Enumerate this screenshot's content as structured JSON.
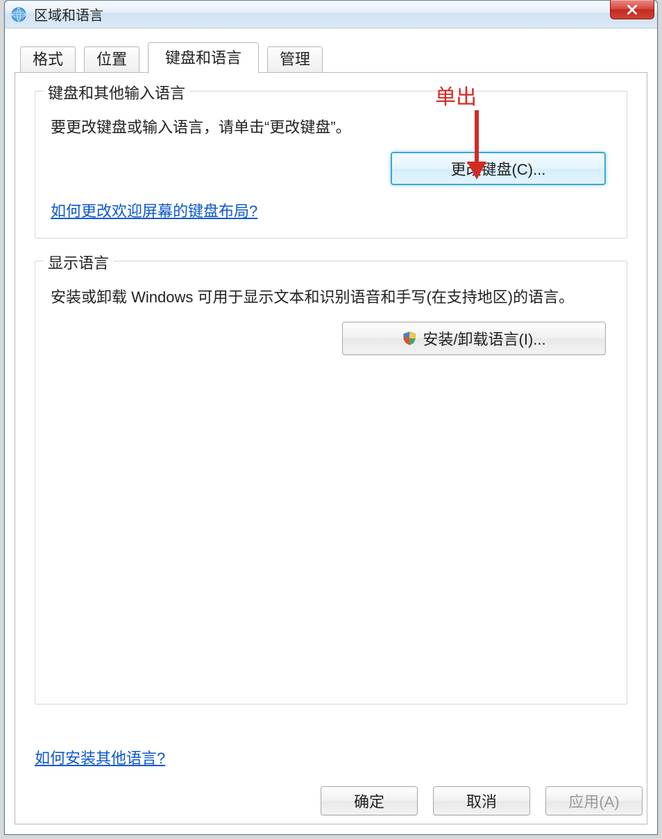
{
  "window": {
    "title": "区域和语言"
  },
  "tabs": {
    "format": "格式",
    "location": "位置",
    "keyboards": "键盘和语言",
    "admin": "管理"
  },
  "group1": {
    "title": "键盘和其他输入语言",
    "desc": "要更改键盘或输入语言，请单击“更改键盘”。",
    "button": "更改键盘(C)...",
    "link": "如何更改欢迎屏幕的键盘布局?"
  },
  "group2": {
    "title": "显示语言",
    "desc": "安装或卸载 Windows 可用于显示文本和识别语音和手写(在支持地区)的语言。",
    "button": "安装/卸载语言(I)..."
  },
  "bottomLink": "如何安装其他语言?",
  "footer": {
    "ok": "确定",
    "cancel": "取消",
    "apply": "应用(A)"
  },
  "annotation": {
    "label": "单出"
  }
}
